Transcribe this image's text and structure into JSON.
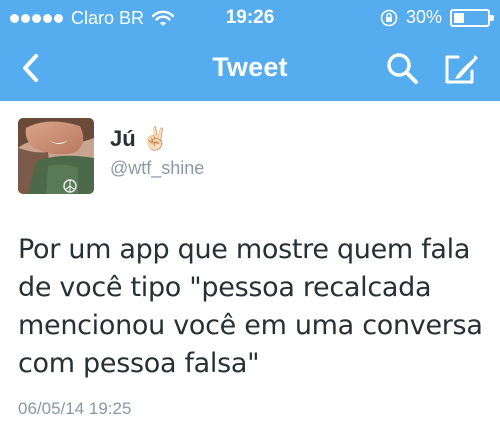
{
  "status_bar": {
    "carrier": "Claro BR",
    "time": "19:26",
    "battery": "30%",
    "battery_level": 0.3,
    "signal_bars": 5,
    "icons": [
      "signal-dots-icon",
      "wifi-icon",
      "rotation-lock-icon",
      "battery-icon"
    ]
  },
  "navbar": {
    "title": "Tweet",
    "icons": [
      "back-chevron-icon",
      "search-icon",
      "compose-icon"
    ]
  },
  "tweet": {
    "author_name": "Jú",
    "author_emoji": "✌🏻",
    "handle": "@wtf_shine",
    "text_lines": [
      "Por um app que mostre quem fala",
      "de você tipo \"pessoa recalcada",
      "mencionou você em uma conversa",
      "com pessoa falsa\""
    ],
    "timestamp": "06/05/14 19:25"
  },
  "colors": {
    "bar": "#55acee",
    "text": "#292f33",
    "muted": "#8899a6"
  }
}
